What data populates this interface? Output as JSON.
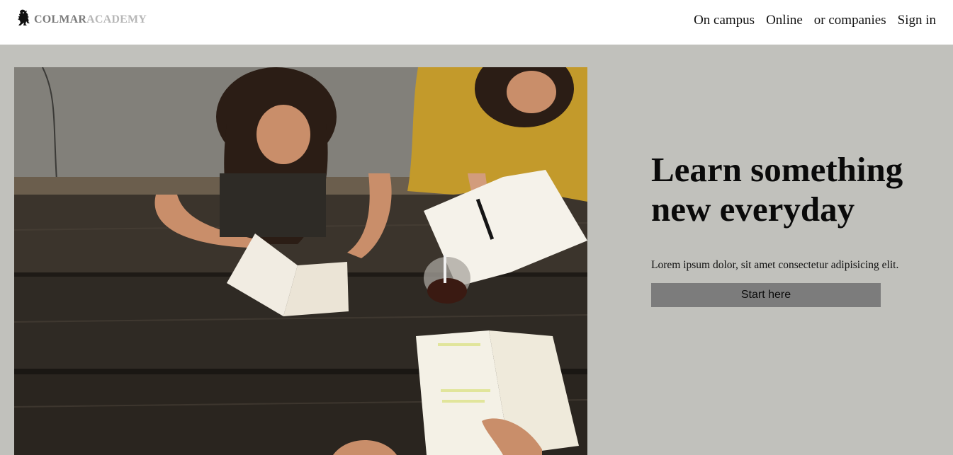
{
  "header": {
    "brand_part1": "COLMAR",
    "brand_part2": "ACADEMY",
    "logo_icon": "lion-rampant-icon",
    "nav": [
      {
        "label": "On campus"
      },
      {
        "label": "Online"
      },
      {
        "label": "or companies"
      },
      {
        "label": "Sign in"
      }
    ]
  },
  "hero": {
    "title": "Learn something new everyday",
    "subtitle": "Lorem ipsum dolor, sit amet consectetur adipisicing elit.",
    "cta_label": "Start here",
    "image_alt": "students-studying-photo"
  },
  "colors": {
    "header_bg": "#ffffff",
    "page_bg": "#c1c1bc",
    "button_bg": "#7c7c7c"
  }
}
